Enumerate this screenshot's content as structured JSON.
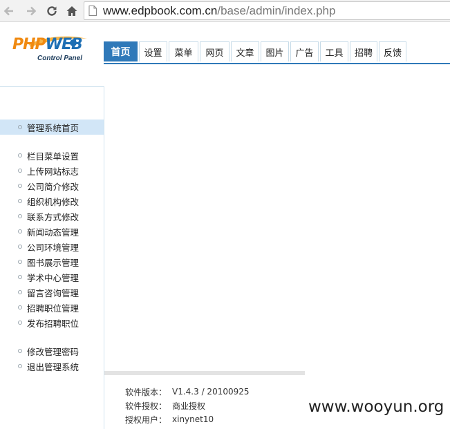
{
  "browser": {
    "url_host": "www.edpbook.com.cn",
    "url_path": "/base/admin/index.php"
  },
  "logo": {
    "main_a": "PHP",
    "main_b": "WEB",
    "sub": "Control Panel"
  },
  "tabs": [
    {
      "label": "首页",
      "active": true
    },
    {
      "label": "设置"
    },
    {
      "label": "菜单"
    },
    {
      "label": "网页"
    },
    {
      "label": "文章"
    },
    {
      "label": "图片"
    },
    {
      "label": "广告"
    },
    {
      "label": "工具"
    },
    {
      "label": "招聘"
    },
    {
      "label": "反馈"
    }
  ],
  "sidebar": {
    "top": [
      {
        "label": "管理系统首页",
        "active": true
      }
    ],
    "main": [
      {
        "label": "栏目菜单设置"
      },
      {
        "label": "上传网站标志"
      },
      {
        "label": "公司简介修改"
      },
      {
        "label": "组织机构修改"
      },
      {
        "label": "联系方式修改"
      },
      {
        "label": "新闻动态管理"
      },
      {
        "label": "公司环境管理"
      },
      {
        "label": "图书展示管理"
      },
      {
        "label": "学术中心管理"
      },
      {
        "label": "留言咨询管理"
      },
      {
        "label": "招聘职位管理"
      },
      {
        "label": "发布招聘职位"
      }
    ],
    "bottom": [
      {
        "label": "修改管理密码"
      },
      {
        "label": "退出管理系统"
      }
    ]
  },
  "info": [
    {
      "key": "软件版本：",
      "value": "V1.4.3 / 20100925"
    },
    {
      "key": "软件授权：",
      "value": "商业授权"
    },
    {
      "key": "授权用户：",
      "value": "xinynet10"
    }
  ],
  "watermark": "www.wooyun.org"
}
